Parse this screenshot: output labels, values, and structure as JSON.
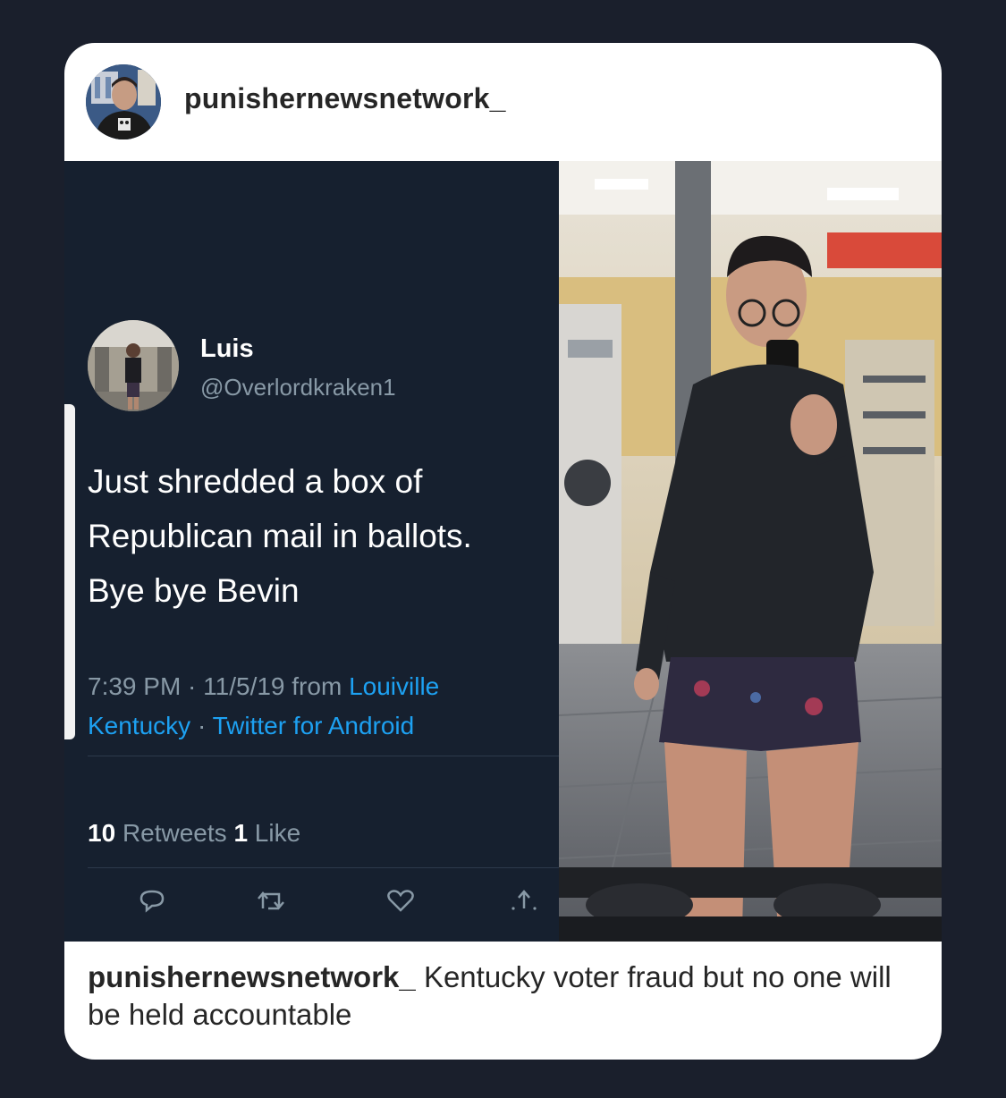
{
  "post": {
    "username": "punishernewsnetwork_",
    "caption_user": "punishernewsnetwork_",
    "caption_text": "Kentucky voter fraud but no one will be held accountable"
  },
  "tweet": {
    "name": "Luis",
    "handle": "@Overlordkraken1",
    "text_lines": [
      "Just shredded a box of",
      "Republican mail in ballots.",
      "Bye bye Bevin"
    ],
    "time": "7:39 PM · 11/5/19 from ",
    "location_part1": "Louiville",
    "location_part2": "Kentucky",
    "separator": " · ",
    "source": "Twitter for Android",
    "retweets_count": "10",
    "retweets_label": "Retweets",
    "likes_count": "1",
    "likes_label": "Like"
  },
  "icons": [
    "reply-icon",
    "retweet-icon",
    "like-icon",
    "share-icon"
  ],
  "colors": {
    "background": "#1a1f2c",
    "tweet_bg": "#16202f",
    "twitter_link": "#1da1f2",
    "muted": "#8899a6"
  }
}
